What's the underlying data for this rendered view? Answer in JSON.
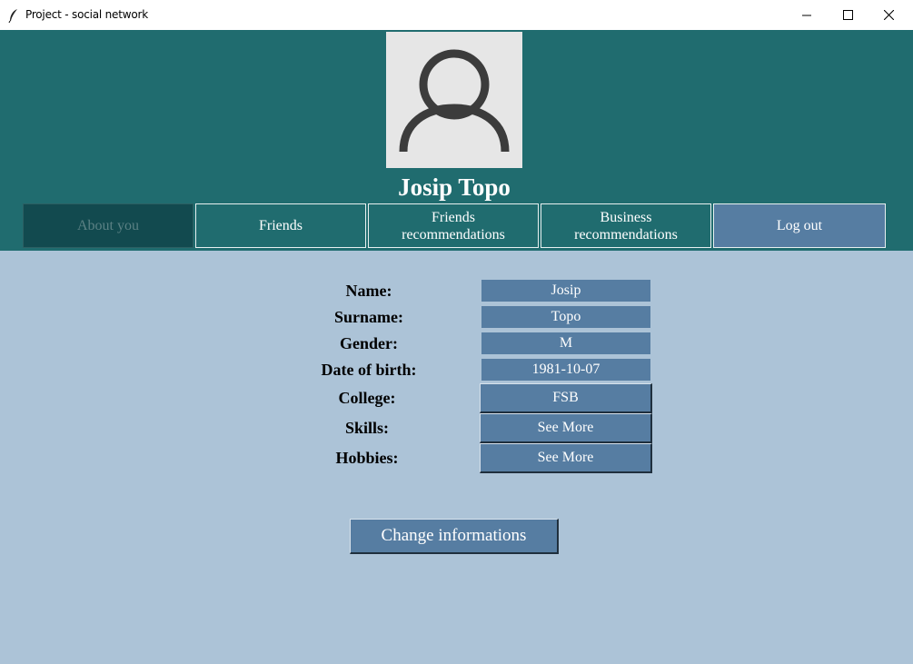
{
  "window": {
    "title": "Project - social network",
    "app_icon": "feather-icon",
    "controls": [
      "minimize-icon",
      "maximize-icon",
      "close-icon"
    ]
  },
  "colors": {
    "header_bg": "#206c6f",
    "content_bg": "#acc3d7",
    "button_bg": "#567da2",
    "active_tab_bg": "#124a4f"
  },
  "profile": {
    "avatar_icon": "user-avatar-icon",
    "name": "Josip Topo"
  },
  "nav": {
    "about": "About you",
    "friends": "Friends",
    "friends_rec": "Friends\nrecommendations",
    "business_rec": "Business\nrecommendations",
    "logout": "Log out",
    "active_tab": "About you"
  },
  "info": {
    "name_label": "Name:",
    "name_value": "Josip",
    "surname_label": "Surname:",
    "surname_value": "Topo",
    "gender_label": "Gender:",
    "gender_value": "M",
    "dob_label": "Date of birth:",
    "dob_value": "1981-10-07",
    "college_label": "College:",
    "college_value": "FSB",
    "skills_label": "Skills:",
    "skills_button": "See More",
    "hobbies_label": "Hobbies:",
    "hobbies_button": "See More"
  },
  "actions": {
    "change_label": "Change informations"
  }
}
